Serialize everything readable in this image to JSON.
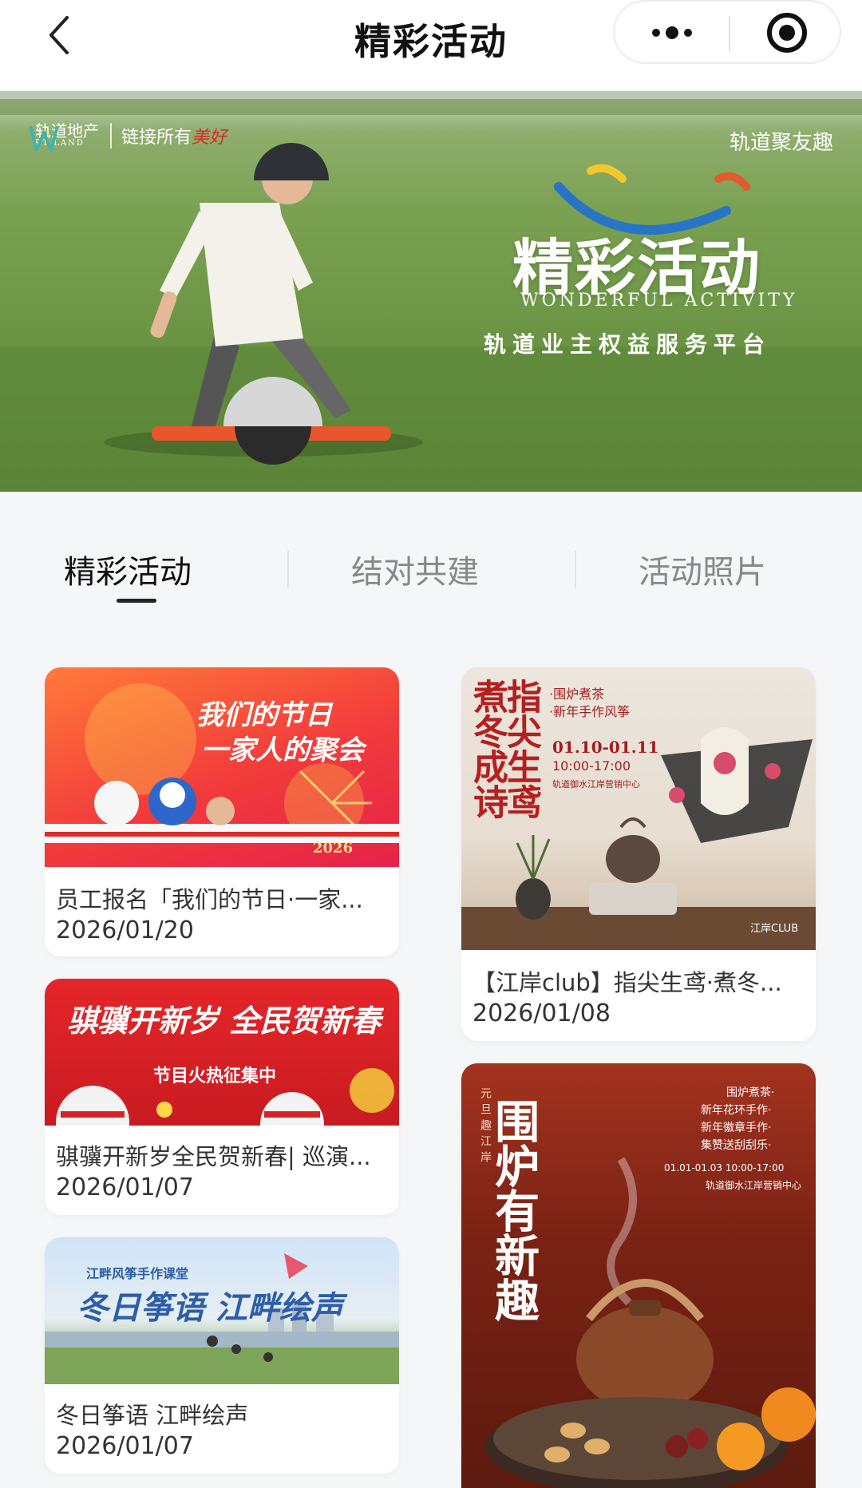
{
  "nav": {
    "title": "精彩活动"
  },
  "banner": {
    "logo_text": "轨道地产",
    "logo_sub": "RT LAND",
    "slogan_prefix": "链接所有",
    "slogan_suffix": "美好",
    "brand": "轨道聚友趣",
    "headline": "精彩活动",
    "subtitle_en": "WONDERFUL ACTIVITY",
    "subtitle_cn": "轨道业主权益服务平台"
  },
  "tabs": [
    {
      "label": "精彩活动"
    },
    {
      "label": "结对共建"
    },
    {
      "label": "活动照片"
    }
  ],
  "cards": [
    {
      "title": "员工报名「我们的节日·一家...",
      "date": "2026/01/20",
      "image_text": {
        "line1": "我们的节日",
        "line2": "一家人的聚会",
        "year": "2026"
      }
    },
    {
      "title": "【江岸club】指尖生鸢·煮冬...",
      "date": "2026/01/08",
      "image_text": {
        "col1": "指尖生鸢",
        "col2": "煮冬成诗",
        "item1": "·围炉煮茶",
        "item2": "·新年手作风筝",
        "dates": "01.10-01.11",
        "times": "10:00-17:00",
        "venue": "轨道御水江岸营销中心",
        "club": "江岸CLUB"
      }
    },
    {
      "title": "骐骥开新岁全民贺新春| 巡演...",
      "date": "2026/01/07",
      "image_text": {
        "headline": "骐骥开新岁 全民贺新春",
        "sub": "节目火热征集中"
      }
    },
    {
      "title": "冬日筝语 江畔绘声",
      "date": "2026/01/07",
      "image_text": {
        "top": "江畔风筝手作课堂",
        "headline": "冬日筝语 江畔绘声"
      }
    },
    {
      "image_text": {
        "headline": "围炉有新趣",
        "side": "元旦趣江岸",
        "list": [
          "围炉煮茶·",
          "新年花环手作·",
          "新年徽章手作·",
          "集赞送刮刮乐·"
        ],
        "dates": "01.01-01.03 10:00-17:00",
        "venue": "轨道御水江岸营销中心"
      }
    }
  ]
}
